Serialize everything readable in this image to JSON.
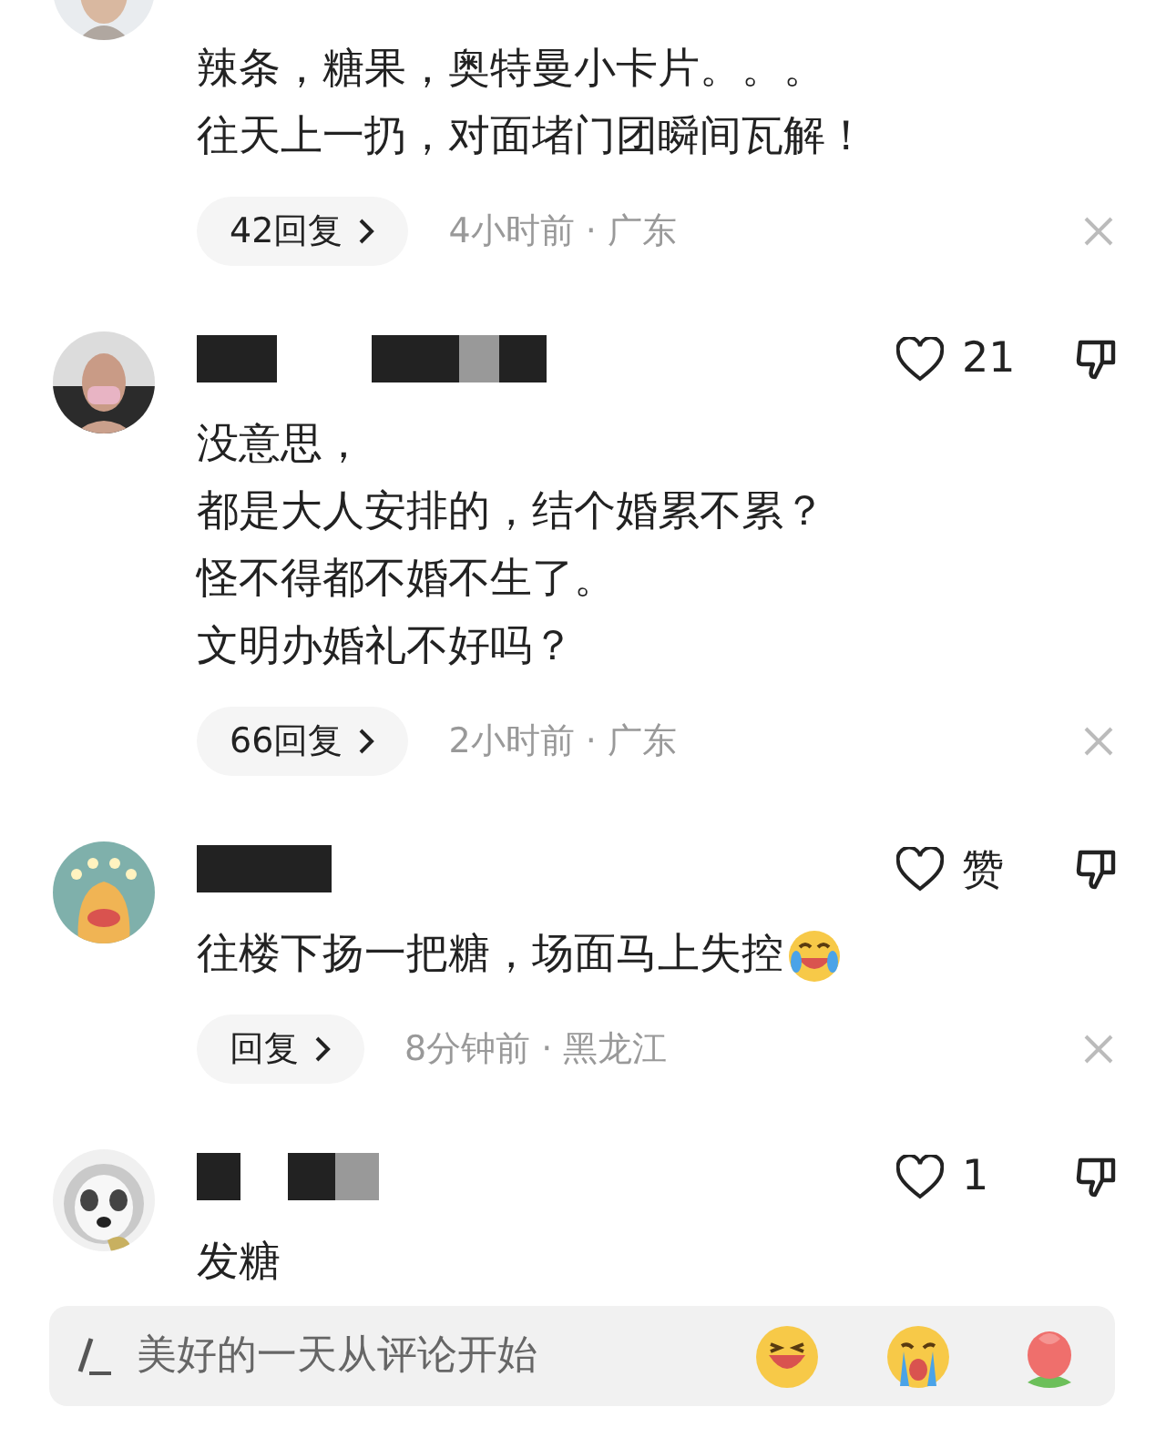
{
  "comments": [
    {
      "avatar": {
        "kind": "picture"
      },
      "lines": [
        "辣条，糖果，奥特曼小卡片。。。",
        "往天上一扔，对面堵门团瞬间瓦解！"
      ],
      "replies": "42回复",
      "meta": "4小时前 · 广东"
    },
    {
      "avatar": {
        "kind": "picture"
      },
      "like": "21",
      "lines": [
        "没意思，",
        "都是大人安排的，结个婚累不累？",
        "怪不得都不婚不生了。",
        "文明办婚礼不好吗？"
      ],
      "replies": "66回复",
      "meta": "2小时前 · 广东"
    },
    {
      "avatar": {
        "kind": "picture"
      },
      "like": "赞",
      "lines": [
        "往楼下扬一把糖，场面马上失控"
      ],
      "emoji": true,
      "replies": "回复",
      "meta": "8分钟前 · 黑龙江"
    },
    {
      "avatar": {
        "kind": "picture"
      },
      "like": "1",
      "lines": [
        "发糖"
      ]
    }
  ],
  "comment_box": {
    "placeholder": "美好的一天从评论开始"
  }
}
